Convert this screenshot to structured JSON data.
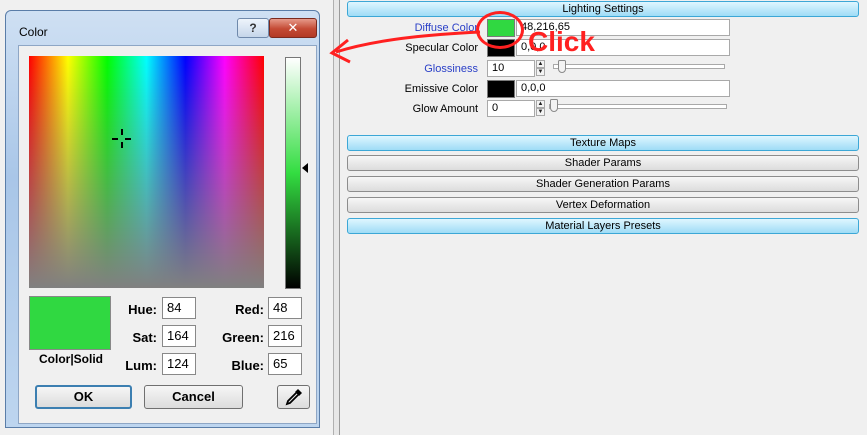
{
  "dialog": {
    "title": "Color",
    "help_label": "?",
    "close_label": "✕",
    "hue_label": "Hue:",
    "hue": "84",
    "sat_label": "Sat:",
    "sat": "164",
    "lum_label": "Lum:",
    "lum": "124",
    "red_label": "Red:",
    "red": "48",
    "green_label": "Green:",
    "green": "216",
    "blue_label": "Blue:",
    "blue": "65",
    "preview_label": "Color|Solid",
    "ok_label": "OK",
    "cancel_label": "Cancel",
    "selected_color": "#30d841",
    "eyedropper_icon": "eyedropper-icon"
  },
  "panel": {
    "lighting_header": "Lighting Settings",
    "diffuse_label": "Diffuse Color",
    "diffuse_value": "48,216,65",
    "diffuse_color": "#30d841",
    "specular_label": "Specular Color",
    "specular_value": "0,0,0",
    "specular_color": "#000000",
    "glossiness_label": "Glossiness",
    "glossiness_value": "10",
    "emissive_label": "Emissive Color",
    "emissive_value": "0,0,0",
    "emissive_color": "#000000",
    "glow_label": "Glow Amount",
    "glow_value": "0",
    "sections": [
      "Texture Maps",
      "Shader Params",
      "Shader Generation Params",
      "Vertex Deformation",
      "Material Layers Presets"
    ]
  },
  "annotation": {
    "click_text": "Click",
    "accent_color": "#ff2020"
  }
}
